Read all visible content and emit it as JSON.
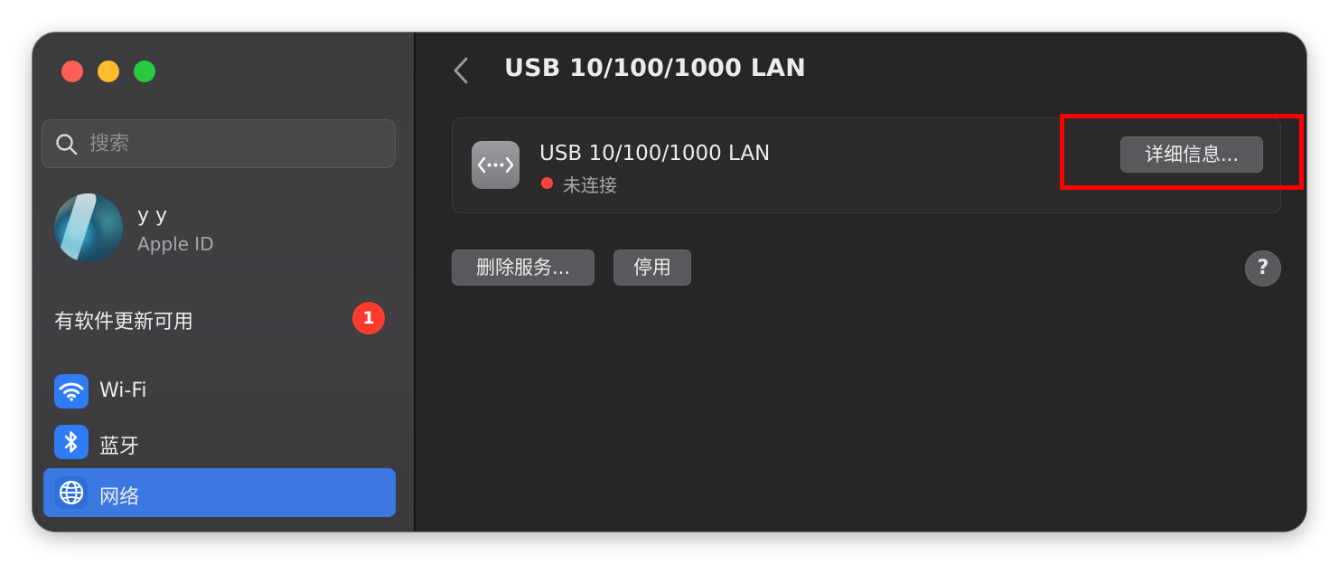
{
  "sidebar": {
    "search_placeholder": "搜索",
    "account": {
      "name": "y y",
      "subtitle": "Apple ID"
    },
    "update": {
      "label": "有软件更新可用",
      "badge": "1",
      "badge_color": "#ff3b30"
    },
    "items": [
      {
        "label": "Wi-Fi",
        "icon": "wifi-icon",
        "selected": false
      },
      {
        "label": "蓝牙",
        "icon": "bluetooth-icon",
        "selected": false
      },
      {
        "label": "网络",
        "icon": "globe-icon",
        "selected": true
      }
    ],
    "selected_color": "#3b78e2"
  },
  "main": {
    "title": "USB 10/100/1000 LAN",
    "service": {
      "name": "USB 10/100/1000 LAN",
      "icon": "ethernet-arrows-icon",
      "status": "未连接",
      "status_color": "#ff453a",
      "details_button": "详细信息..."
    },
    "actions": {
      "remove_button": "删除服务...",
      "disable_button": "停用"
    },
    "help_button": "?"
  },
  "annotation": {
    "highlight_color": "#ff0000",
    "target": "details-button"
  }
}
